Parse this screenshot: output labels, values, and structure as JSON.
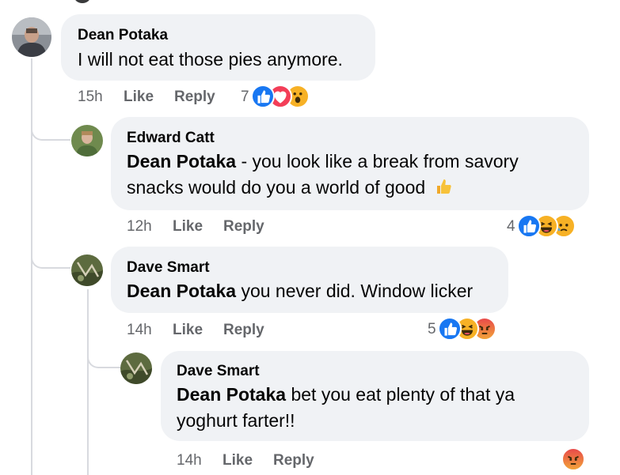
{
  "comments": [
    {
      "author": "Dean Potaka",
      "text": "I will not eat those pies anymore.",
      "time": "15h",
      "like_label": "Like",
      "reply_label": "Reply",
      "reaction_count": "7",
      "reactions": [
        "like-icon",
        "love-icon",
        "wow-icon"
      ]
    },
    {
      "author": "Edward Catt",
      "mention": "Dean Potaka",
      "text_line1": " - you look like a break from savory",
      "text_line2": "snacks would do you a world of good",
      "time": "12h",
      "like_label": "Like",
      "reply_label": "Reply",
      "reaction_count": "4",
      "reactions": [
        "like-icon",
        "haha-icon",
        "sad-icon"
      ]
    },
    {
      "author": "Dave Smart",
      "mention": "Dean Potaka",
      "text": " you never did. Window licker",
      "time": "14h",
      "like_label": "Like",
      "reply_label": "Reply",
      "reaction_count": "5",
      "reactions": [
        "like-icon",
        "haha-icon",
        "angry-icon"
      ]
    },
    {
      "author": "Dave Smart",
      "mention": "Dean Potaka",
      "text_line1": " bet you eat plenty of that ya",
      "text_line2": "yoghurt farter!!",
      "time": "14h",
      "like_label": "Like",
      "reply_label": "Reply",
      "reactions": [
        "angry-icon"
      ]
    }
  ],
  "colors": {
    "bubble": "#f0f2f5",
    "meta_text": "#65676b",
    "thread_line": "#d8dadf",
    "like_blue": "#1877f2",
    "love_red": "#f33e58",
    "emoji_yellow": "#f7b125",
    "angry_red": "#e9710f"
  }
}
